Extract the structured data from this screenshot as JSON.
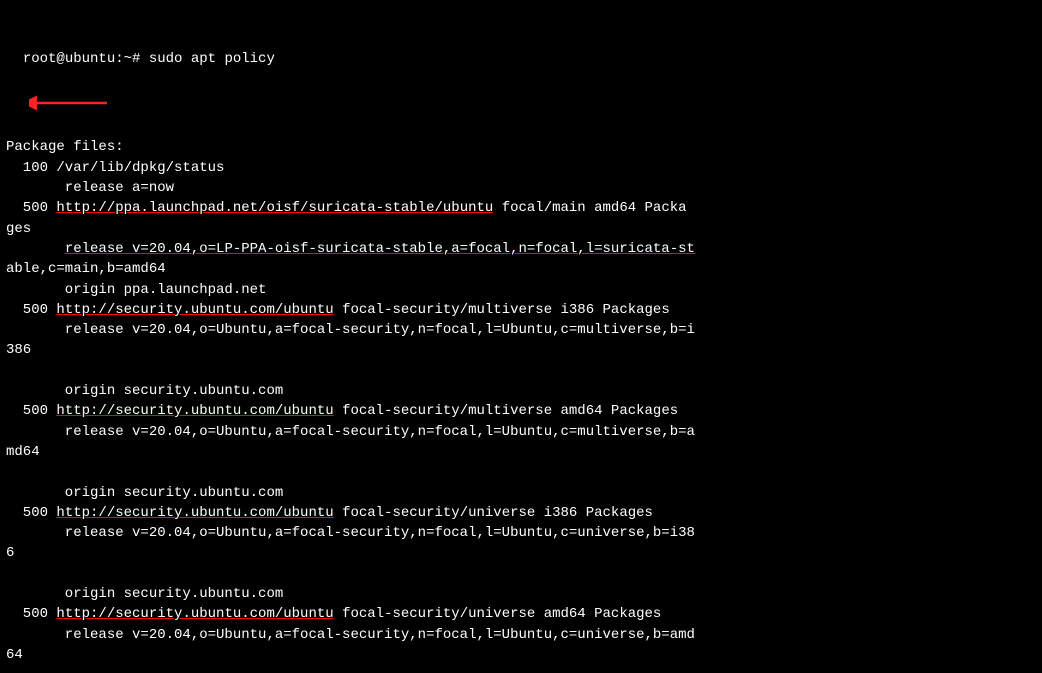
{
  "terminal": {
    "prompt": "root@ubuntu:~# ",
    "command": "sudo apt policy",
    "lines": [
      {
        "text": "Package files:",
        "type": "normal"
      },
      {
        "text": "  100 /var/lib/dpkg/status",
        "type": "normal"
      },
      {
        "text": "       release a=now",
        "type": "normal"
      },
      {
        "text": "  500 ",
        "type": "normal",
        "url": "http://ppa.launchpad.net/oisf/suricata-stable/ubuntu",
        "after": " focal/main amd64 Packa"
      },
      {
        "text": "ges",
        "type": "normal"
      },
      {
        "text": "       ",
        "type": "normal",
        "release_underline": "release v=20.04,o=LP-PPA-oisf-suricata-stable,a=focal,n=focal,l=suricata-st",
        "after": ""
      },
      {
        "text": "able,c=main,b=amd64",
        "type": "normal"
      },
      {
        "text": "       origin ppa.launchpad.net",
        "type": "normal"
      },
      {
        "text": "  500 ",
        "type": "normal",
        "url": "http://security.ubuntu.com/ubuntu",
        "after": " focal-security/multiverse i386 Packages"
      },
      {
        "text": "       release v=20.04,o=Ubuntu,a=focal-security,n=focal,l=Ubuntu,c=multiverse,b=i",
        "type": "normal"
      },
      {
        "text": "386",
        "type": "normal"
      },
      {
        "text": "",
        "type": "normal"
      },
      {
        "text": "       origin security.ubuntu.com",
        "type": "normal"
      },
      {
        "text": "  500 ",
        "type": "normal",
        "url": "http://security.ubuntu.com/ubuntu",
        "after": " focal-security/multiverse amd64 Packages"
      },
      {
        "text": "       release v=20.04,o=Ubuntu,a=focal-security,n=focal,l=Ubuntu,c=multiverse,b=a",
        "type": "normal"
      },
      {
        "text": "md64",
        "type": "normal"
      },
      {
        "text": "",
        "type": "normal"
      },
      {
        "text": "       origin security.ubuntu.com",
        "type": "normal"
      },
      {
        "text": "  500 ",
        "type": "normal",
        "url": "http://security.ubuntu.com/ubuntu",
        "after": " focal-security/universe i386 Packages"
      },
      {
        "text": "       release v=20.04,o=Ubuntu,a=focal-security,n=focal,l=Ubuntu,c=universe,b=i38",
        "type": "normal"
      },
      {
        "text": "6",
        "type": "normal"
      },
      {
        "text": "",
        "type": "normal"
      },
      {
        "text": "       origin security.ubuntu.com",
        "type": "normal"
      },
      {
        "text": "  500 ",
        "type": "normal",
        "url": "http://security.ubuntu.com/ubuntu",
        "after": " focal-security/universe amd64 Packages"
      },
      {
        "text": "       release v=20.04,o=Ubuntu,a=focal-security,n=focal,l=Ubuntu,c=universe,b=amd",
        "type": "normal"
      },
      {
        "text": "64",
        "type": "normal"
      }
    ]
  },
  "arrow": {
    "label": "red arrow pointing left"
  }
}
